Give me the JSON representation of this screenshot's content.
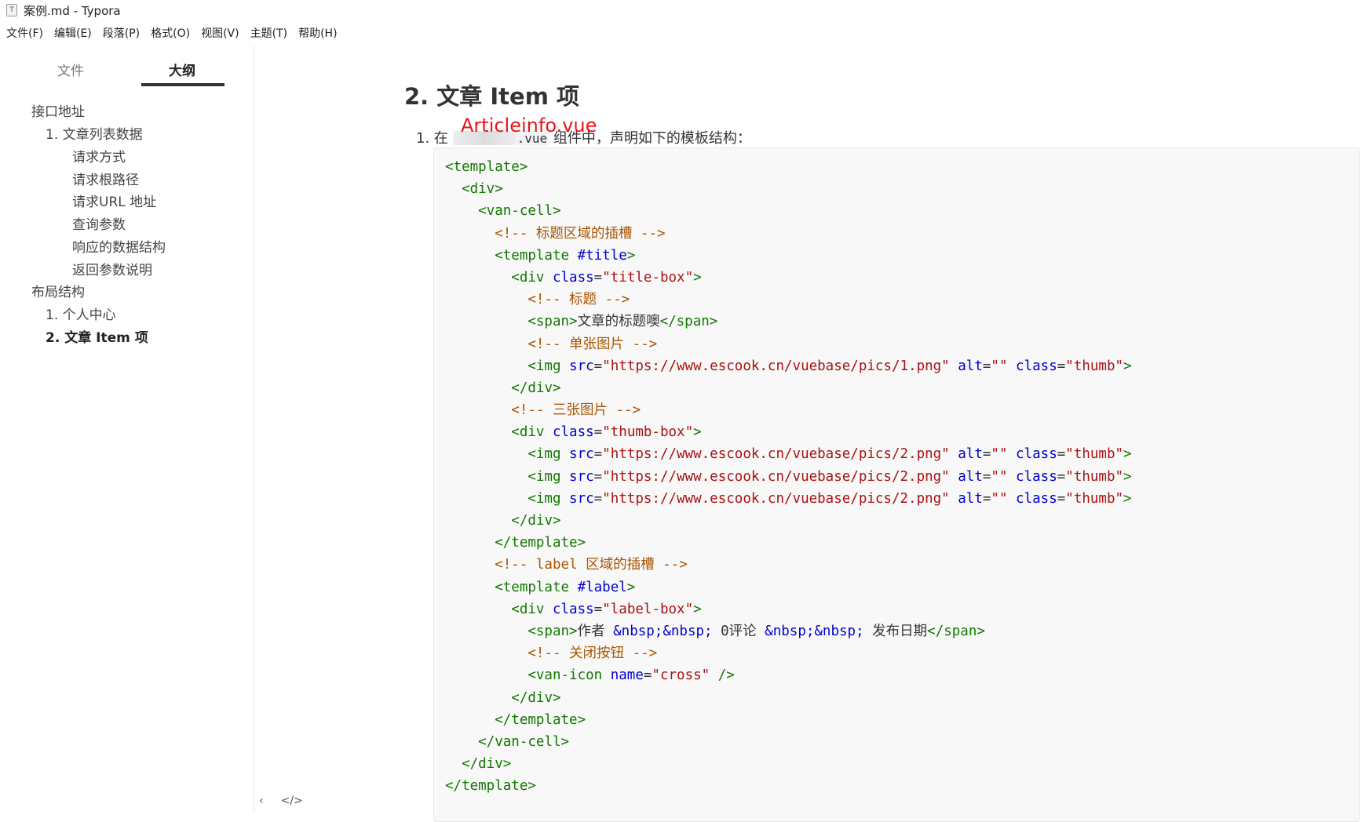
{
  "window": {
    "title": "案例.md - Typora",
    "icon_letter": "T"
  },
  "menubar": {
    "items": [
      "文件(F)",
      "编辑(E)",
      "段落(P)",
      "格式(O)",
      "视图(V)",
      "主题(T)",
      "帮助(H)"
    ]
  },
  "sidebar": {
    "tabs": {
      "files": "文件",
      "outline": "大纲"
    },
    "outline": [
      {
        "label": "接口地址",
        "level": 1
      },
      {
        "label": "1. 文章列表数据",
        "level": 2
      },
      {
        "label": "请求方式",
        "level": 3
      },
      {
        "label": "请求根路径",
        "level": 3
      },
      {
        "label": "请求URL 地址",
        "level": 3
      },
      {
        "label": "查询参数",
        "level": 3
      },
      {
        "label": "响应的数据结构",
        "level": 3
      },
      {
        "label": "返回参数说明",
        "level": 3
      },
      {
        "label": "布局结构",
        "level": 1
      },
      {
        "label": "1. 个人中心",
        "level": 2
      },
      {
        "label": "2. 文章 Item 项",
        "level": 2,
        "active": true
      }
    ],
    "footer": {
      "back_icon": "‹",
      "source_icon": "</>"
    }
  },
  "content": {
    "heading": "2. 文章 Item 项",
    "list_item": {
      "number": "1. 在",
      "file_suffix": ".vue",
      "text": "组件中，声明如下的模板结构："
    },
    "annotation": "Articleinfo.vue",
    "code_lines": [
      [
        [
          "tag",
          "<template>"
        ]
      ],
      [
        [
          "text",
          "  "
        ],
        [
          "tag",
          "<div>"
        ]
      ],
      [
        [
          "text",
          "    "
        ],
        [
          "tag",
          "<van-cell>"
        ]
      ],
      [
        [
          "text",
          "      "
        ],
        [
          "comment",
          "<!-- 标题区域的插槽 -->"
        ]
      ],
      [
        [
          "text",
          "      "
        ],
        [
          "tag",
          "<template "
        ],
        [
          "attr",
          "#title"
        ],
        [
          "tag",
          ">"
        ]
      ],
      [
        [
          "text",
          "        "
        ],
        [
          "tag",
          "<div "
        ],
        [
          "attr",
          "class"
        ],
        [
          "text",
          "="
        ],
        [
          "str",
          "\"title-box\""
        ],
        [
          "tag",
          ">"
        ]
      ],
      [
        [
          "text",
          "          "
        ],
        [
          "comment",
          "<!-- 标题 -->"
        ]
      ],
      [
        [
          "text",
          "          "
        ],
        [
          "tag",
          "<span>"
        ],
        [
          "text",
          "文章的标题噢"
        ],
        [
          "tag",
          "</span>"
        ]
      ],
      [
        [
          "text",
          "          "
        ],
        [
          "comment",
          "<!-- 单张图片 -->"
        ]
      ],
      [
        [
          "text",
          "          "
        ],
        [
          "tag",
          "<img "
        ],
        [
          "attr",
          "src"
        ],
        [
          "text",
          "="
        ],
        [
          "str",
          "\"https://www.escook.cn/vuebase/pics/1.png\""
        ],
        [
          "text",
          " "
        ],
        [
          "attr",
          "alt"
        ],
        [
          "text",
          "="
        ],
        [
          "str",
          "\"\""
        ],
        [
          "text",
          " "
        ],
        [
          "attr",
          "class"
        ],
        [
          "text",
          "="
        ],
        [
          "str",
          "\"thumb\""
        ],
        [
          "tag",
          ">"
        ]
      ],
      [
        [
          "text",
          "        "
        ],
        [
          "tag",
          "</div>"
        ]
      ],
      [
        [
          "text",
          "        "
        ],
        [
          "comment",
          "<!-- 三张图片 -->"
        ]
      ],
      [
        [
          "text",
          "        "
        ],
        [
          "tag",
          "<div "
        ],
        [
          "attr",
          "class"
        ],
        [
          "text",
          "="
        ],
        [
          "str",
          "\"thumb-box\""
        ],
        [
          "tag",
          ">"
        ]
      ],
      [
        [
          "text",
          "          "
        ],
        [
          "tag",
          "<img "
        ],
        [
          "attr",
          "src"
        ],
        [
          "text",
          "="
        ],
        [
          "str",
          "\"https://www.escook.cn/vuebase/pics/2.png\""
        ],
        [
          "text",
          " "
        ],
        [
          "attr",
          "alt"
        ],
        [
          "text",
          "="
        ],
        [
          "str",
          "\"\""
        ],
        [
          "text",
          " "
        ],
        [
          "attr",
          "class"
        ],
        [
          "text",
          "="
        ],
        [
          "str",
          "\"thumb\""
        ],
        [
          "tag",
          ">"
        ]
      ],
      [
        [
          "text",
          "          "
        ],
        [
          "tag",
          "<img "
        ],
        [
          "attr",
          "src"
        ],
        [
          "text",
          "="
        ],
        [
          "str",
          "\"https://www.escook.cn/vuebase/pics/2.png\""
        ],
        [
          "text",
          " "
        ],
        [
          "attr",
          "alt"
        ],
        [
          "text",
          "="
        ],
        [
          "str",
          "\"\""
        ],
        [
          "text",
          " "
        ],
        [
          "attr",
          "class"
        ],
        [
          "text",
          "="
        ],
        [
          "str",
          "\"thumb\""
        ],
        [
          "tag",
          ">"
        ]
      ],
      [
        [
          "text",
          "          "
        ],
        [
          "tag",
          "<img "
        ],
        [
          "attr",
          "src"
        ],
        [
          "text",
          "="
        ],
        [
          "str",
          "\"https://www.escook.cn/vuebase/pics/2.png\""
        ],
        [
          "text",
          " "
        ],
        [
          "attr",
          "alt"
        ],
        [
          "text",
          "="
        ],
        [
          "str",
          "\"\""
        ],
        [
          "text",
          " "
        ],
        [
          "attr",
          "class"
        ],
        [
          "text",
          "="
        ],
        [
          "str",
          "\"thumb\""
        ],
        [
          "tag",
          ">"
        ]
      ],
      [
        [
          "text",
          "        "
        ],
        [
          "tag",
          "</div>"
        ]
      ],
      [
        [
          "text",
          "      "
        ],
        [
          "tag",
          "</template>"
        ]
      ],
      [
        [
          "text",
          "      "
        ],
        [
          "comment",
          "<!-- label 区域的插槽 -->"
        ]
      ],
      [
        [
          "text",
          "      "
        ],
        [
          "tag",
          "<template "
        ],
        [
          "attr",
          "#label"
        ],
        [
          "tag",
          ">"
        ]
      ],
      [
        [
          "text",
          "        "
        ],
        [
          "tag",
          "<div "
        ],
        [
          "attr",
          "class"
        ],
        [
          "text",
          "="
        ],
        [
          "str",
          "\"label-box\""
        ],
        [
          "tag",
          ">"
        ]
      ],
      [
        [
          "text",
          "          "
        ],
        [
          "tag",
          "<span>"
        ],
        [
          "text",
          "作者 "
        ],
        [
          "attr",
          "&nbsp;&nbsp;"
        ],
        [
          "text",
          " 0评论 "
        ],
        [
          "attr",
          "&nbsp;&nbsp;"
        ],
        [
          "text",
          " 发布日期"
        ],
        [
          "tag",
          "</span>"
        ]
      ],
      [
        [
          "text",
          "          "
        ],
        [
          "comment",
          "<!-- 关闭按钮 -->"
        ]
      ],
      [
        [
          "text",
          "          "
        ],
        [
          "tag",
          "<van-icon "
        ],
        [
          "attr",
          "name"
        ],
        [
          "text",
          "="
        ],
        [
          "str",
          "\"cross\""
        ],
        [
          "tag",
          " />"
        ]
      ],
      [
        [
          "text",
          "        "
        ],
        [
          "tag",
          "</div>"
        ]
      ],
      [
        [
          "text",
          "      "
        ],
        [
          "tag",
          "</template>"
        ]
      ],
      [
        [
          "text",
          "    "
        ],
        [
          "tag",
          "</van-cell>"
        ]
      ],
      [
        [
          "text",
          "  "
        ],
        [
          "tag",
          "</div>"
        ]
      ],
      [
        [
          "tag",
          "</template>"
        ]
      ]
    ]
  }
}
